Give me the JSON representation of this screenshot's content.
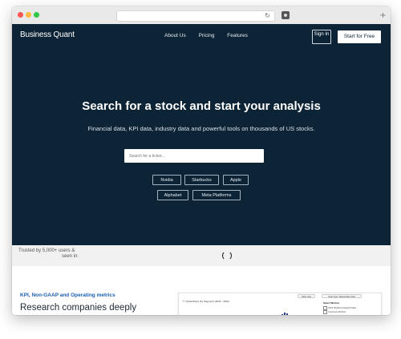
{
  "header": {
    "brand": "Business Quant",
    "nav": [
      "About Us",
      "Pricing",
      "Features"
    ],
    "signin": "Sign In",
    "cta": "Start for Free"
  },
  "hero": {
    "title": "Search for a stock and start your analysis",
    "subtitle": "Financial data, KPI data, industry data and powerful tools on thousands of US stocks.",
    "search_placeholder": "Search for a ticker...",
    "suggestions": [
      "Nvidia",
      "Starbucks",
      "Apple",
      "Alphabet",
      "Meta Platforms"
    ]
  },
  "trusted": {
    "line1": "Trusted by 5,000+ users &",
    "line2": "seen in:"
  },
  "features": {
    "kpi_label": "KPI, Non-GAAP and Operating metrics",
    "heading": "Research companies deeply"
  },
  "preview": {
    "chart_title": "T | Subscribers (by Segment) (2016 - 2023)",
    "btn1": "Table View",
    "btn2": "Chart Type: Stacked Bar Chart",
    "select_title": "Select Metrics",
    "metrics": [
      "AT&T Mobility Postpaid (Subs)",
      "Consumer Wireline"
    ]
  },
  "colors": {
    "navy": "#0c2436",
    "link_blue": "#1a5fb4"
  }
}
